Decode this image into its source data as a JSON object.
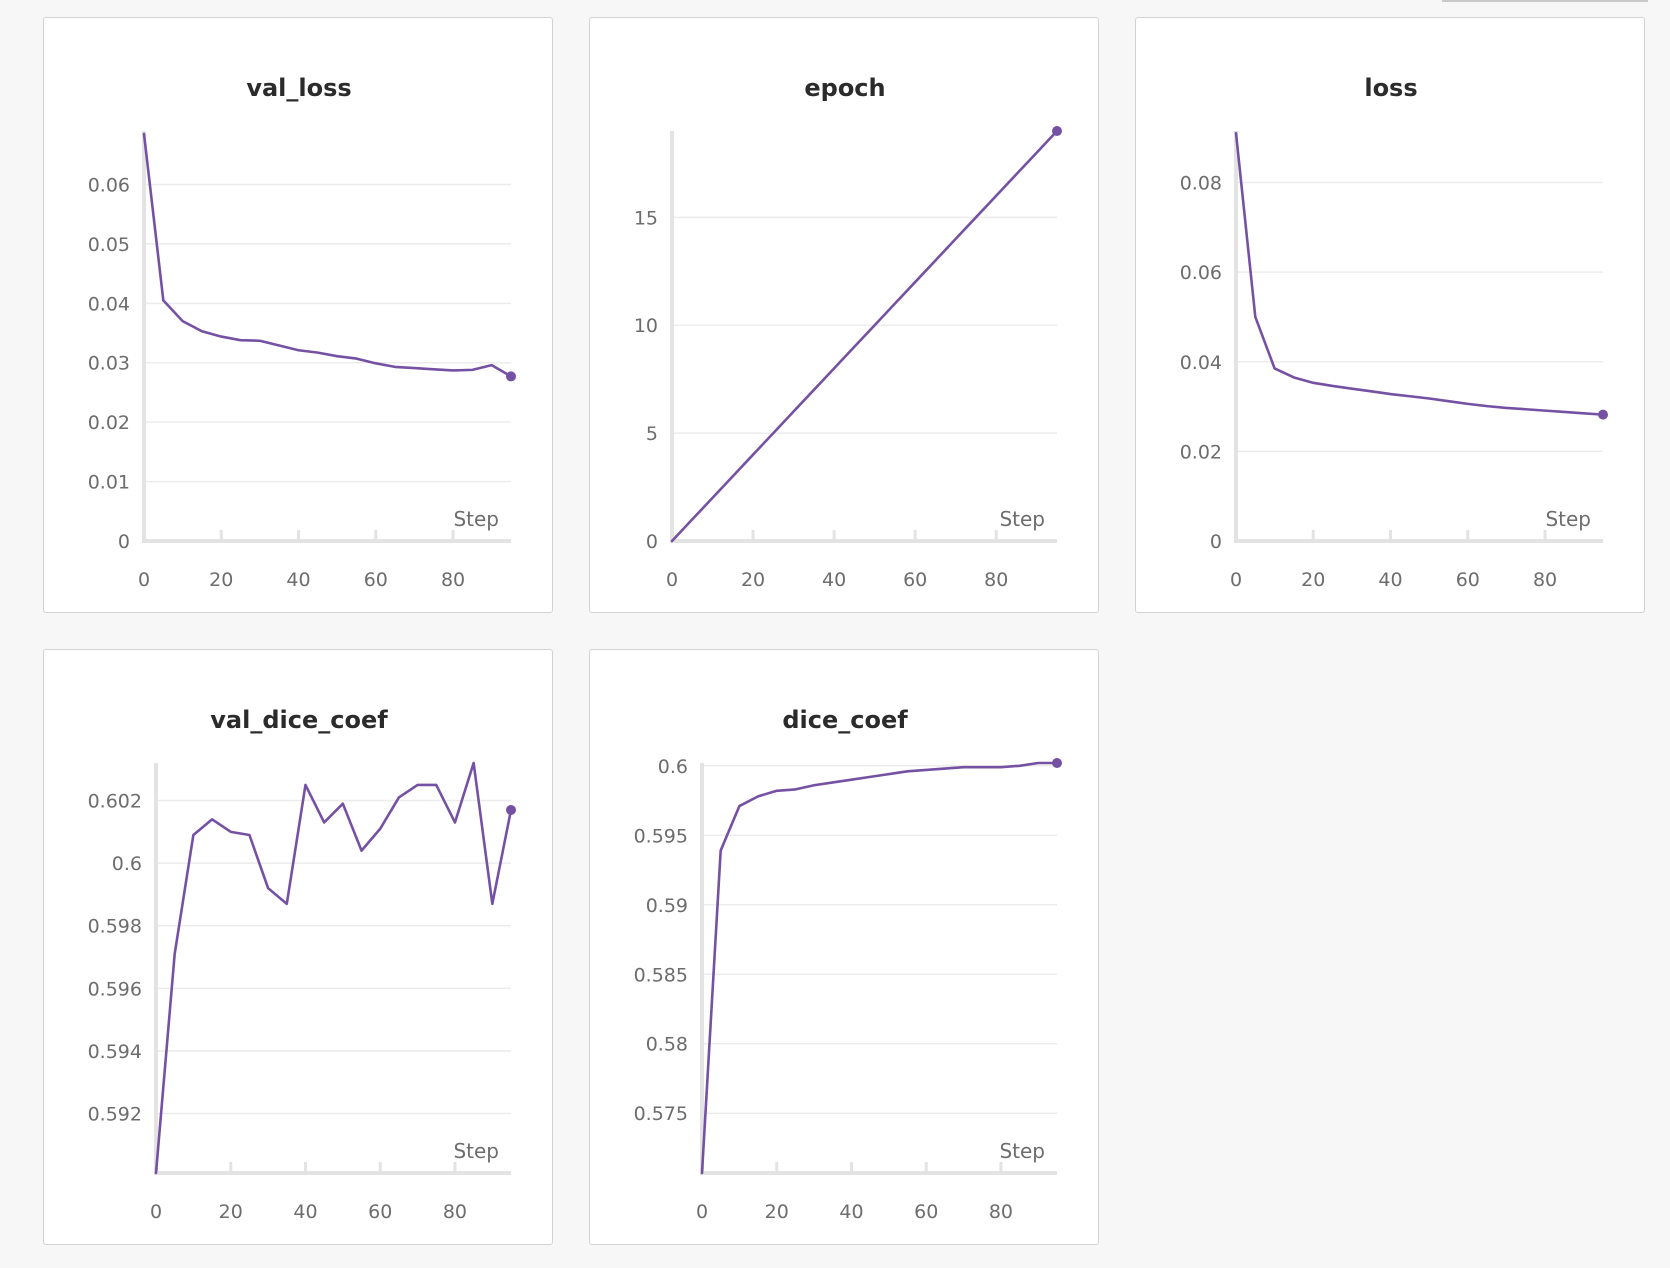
{
  "colors": {
    "series": "#7551a3",
    "background": "#f7f7f7"
  },
  "chart_data": [
    {
      "type": "line",
      "title": "val_loss",
      "xlabel": "Step",
      "ylabel": "",
      "xlim": [
        0,
        95
      ],
      "ylim": [
        0,
        0.069
      ],
      "x_ticks": [
        0,
        20,
        40,
        60,
        80
      ],
      "y_ticks": [
        0,
        0.01,
        0.02,
        0.03,
        0.04,
        0.05,
        0.06
      ],
      "y_tick_labels": [
        "0",
        "0.01",
        "0.02",
        "0.03",
        "0.04",
        "0.05",
        "0.06"
      ],
      "grid": true,
      "series": [
        {
          "x": [
            0,
            5,
            10,
            15,
            20,
            25,
            30,
            35,
            40,
            45,
            50,
            55,
            60,
            65,
            70,
            75,
            80,
            85,
            90,
            95
          ],
          "y": [
            0.0685,
            0.0405,
            0.037,
            0.0353,
            0.0344,
            0.0338,
            0.0337,
            0.0329,
            0.0321,
            0.0317,
            0.0311,
            0.0307,
            0.0299,
            0.0293,
            0.0291,
            0.0289,
            0.0287,
            0.0288,
            0.0296,
            0.0277
          ]
        }
      ]
    },
    {
      "type": "line",
      "title": "epoch",
      "xlabel": "Step",
      "ylabel": "",
      "xlim": [
        0,
        95
      ],
      "ylim": [
        0,
        19
      ],
      "x_ticks": [
        0,
        20,
        40,
        60,
        80
      ],
      "y_ticks": [
        0,
        5,
        10,
        15
      ],
      "y_tick_labels": [
        "0",
        "5",
        "10",
        "15"
      ],
      "grid": true,
      "series": [
        {
          "x": [
            0,
            5,
            10,
            15,
            20,
            25,
            30,
            35,
            40,
            45,
            50,
            55,
            60,
            65,
            70,
            75,
            80,
            85,
            90,
            95
          ],
          "y": [
            0,
            1,
            2,
            3,
            4,
            5,
            6,
            7,
            8,
            9,
            10,
            11,
            12,
            13,
            14,
            15,
            16,
            17,
            18,
            19
          ]
        }
      ]
    },
    {
      "type": "line",
      "title": "loss",
      "xlabel": "Step",
      "ylabel": "",
      "xlim": [
        0,
        95
      ],
      "ylim": [
        0,
        0.0915
      ],
      "x_ticks": [
        0,
        20,
        40,
        60,
        80
      ],
      "y_ticks": [
        0,
        0.02,
        0.04,
        0.06,
        0.08
      ],
      "y_tick_labels": [
        "0",
        "0.02",
        "0.04",
        "0.06",
        "0.08"
      ],
      "grid": true,
      "series": [
        {
          "x": [
            0,
            5,
            10,
            15,
            20,
            25,
            30,
            35,
            40,
            45,
            50,
            55,
            60,
            65,
            70,
            75,
            80,
            85,
            90,
            95
          ],
          "y": [
            0.091,
            0.05,
            0.0385,
            0.0365,
            0.0353,
            0.0346,
            0.034,
            0.0334,
            0.0328,
            0.0323,
            0.0318,
            0.0312,
            0.0306,
            0.0301,
            0.0297,
            0.0294,
            0.0291,
            0.0288,
            0.0285,
            0.0282
          ]
        }
      ]
    },
    {
      "type": "line",
      "title": "val_dice_coef",
      "xlabel": "Step",
      "ylabel": "",
      "xlim": [
        0,
        95
      ],
      "ylim": [
        0.5901,
        0.6032
      ],
      "x_ticks": [
        0,
        20,
        40,
        60,
        80
      ],
      "y_ticks": [
        0.592,
        0.594,
        0.596,
        0.598,
        0.6,
        0.602
      ],
      "y_tick_labels": [
        "0.592",
        "0.594",
        "0.596",
        "0.598",
        "0.6",
        "0.602"
      ],
      "grid": true,
      "series": [
        {
          "x": [
            0,
            5,
            10,
            15,
            20,
            25,
            30,
            35,
            40,
            45,
            50,
            55,
            60,
            65,
            70,
            75,
            80,
            85,
            90,
            95
          ],
          "y": [
            0.5901,
            0.5971,
            0.6009,
            0.6014,
            0.601,
            0.6009,
            0.5992,
            0.5987,
            0.6025,
            0.6013,
            0.6019,
            0.6004,
            0.6011,
            0.6021,
            0.6025,
            0.6025,
            0.6013,
            0.6032,
            0.5987,
            0.6017
          ]
        }
      ]
    },
    {
      "type": "line",
      "title": "dice_coef",
      "xlabel": "Step",
      "ylabel": "",
      "xlim": [
        0,
        95
      ],
      "ylim": [
        0.5707,
        0.6002
      ],
      "x_ticks": [
        0,
        20,
        40,
        60,
        80
      ],
      "y_ticks": [
        0.575,
        0.58,
        0.585,
        0.59,
        0.595,
        0.6
      ],
      "y_tick_labels": [
        "0.575",
        "0.58",
        "0.585",
        "0.59",
        "0.595",
        "0.6"
      ],
      "grid": true,
      "series": [
        {
          "x": [
            0,
            5,
            10,
            15,
            20,
            25,
            30,
            35,
            40,
            45,
            50,
            55,
            60,
            65,
            70,
            75,
            80,
            85,
            90,
            95
          ],
          "y": [
            0.5707,
            0.5939,
            0.5971,
            0.5978,
            0.5982,
            0.5983,
            0.5986,
            0.5988,
            0.599,
            0.5992,
            0.5994,
            0.5996,
            0.5997,
            0.5998,
            0.5999,
            0.5999,
            0.5999,
            0.6,
            0.6002,
            0.6002
          ]
        }
      ]
    }
  ]
}
